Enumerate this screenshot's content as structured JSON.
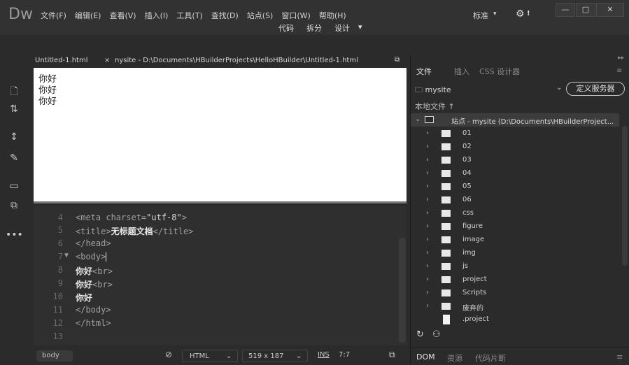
{
  "app": {
    "logo": "Dw"
  },
  "menu": [
    "文件(F)",
    "编辑(E)",
    "查看(V)",
    "插入(I)",
    "工具(T)",
    "查找(D)",
    "站点(S)",
    "窗口(W)",
    "帮助(H)"
  ],
  "workspace": {
    "preset": "标准",
    "caret": "▾",
    "settings_badge": "!"
  },
  "window_controls": {
    "minimize": "—",
    "maximize": "□",
    "close": "✕"
  },
  "views": {
    "code": "代码",
    "split": "拆分",
    "design": "设计",
    "caret": "▾"
  },
  "document": {
    "tab_name": "Untitled-1.html",
    "close": "×",
    "path": "nysite - D:\\Documents\\HBuilderProjects\\HelloHBuilder\\Untitled-1.html"
  },
  "design_view": {
    "lines": [
      "你好",
      "你好",
      "你好"
    ]
  },
  "code_view": {
    "rows": [
      {
        "ln": "4",
        "fold": "",
        "html": "meta"
      },
      {
        "ln": "5",
        "fold": "",
        "html": "title"
      },
      {
        "ln": "6",
        "fold": "",
        "html": "head_close"
      },
      {
        "ln": "7",
        "fold": "▼",
        "html": "body_open"
      },
      {
        "ln": "8",
        "fold": "",
        "html": "hello_br"
      },
      {
        "ln": "9",
        "fold": "",
        "html": "hello_br"
      },
      {
        "ln": "10",
        "fold": "",
        "html": "hello"
      },
      {
        "ln": "11",
        "fold": "",
        "html": "body_close"
      },
      {
        "ln": "12",
        "fold": "",
        "html": "html_close"
      },
      {
        "ln": "13",
        "fold": "",
        "html": "empty"
      }
    ],
    "meta_open": "<meta charset=",
    "meta_val": "\"utf-8\"",
    "meta_close": ">",
    "title_open": "<title>",
    "title_text": "无标题文档",
    "title_close": "</title>",
    "head_close": "</head>",
    "body_open": "<body>",
    "hello": "你好",
    "br": "<br>",
    "body_close": "</body>",
    "html_close": "</html>"
  },
  "status_bar": {
    "tag": "body",
    "language": "HTML",
    "size": "519 x 187",
    "mode": "INS",
    "position": "7:7"
  },
  "right_panel": {
    "tabs": [
      "文件",
      "插入",
      "CSS 设计器"
    ],
    "site": "mysite",
    "define_server": "定义服务器",
    "local_files": "本地文件",
    "local_files_arrow": "↑",
    "root": "站点 - mysite (D:\\Documents\\HBuilderProject...",
    "items": [
      {
        "name": "01",
        "type": "folder"
      },
      {
        "name": "02",
        "type": "folder"
      },
      {
        "name": "03",
        "type": "folder"
      },
      {
        "name": "04",
        "type": "folder"
      },
      {
        "name": "05",
        "type": "folder"
      },
      {
        "name": "06",
        "type": "folder"
      },
      {
        "name": "css",
        "type": "folder"
      },
      {
        "name": "figure",
        "type": "folder"
      },
      {
        "name": "image",
        "type": "folder"
      },
      {
        "name": "img",
        "type": "folder"
      },
      {
        "name": "js",
        "type": "folder"
      },
      {
        "name": "project",
        "type": "folder"
      },
      {
        "name": "Scripts",
        "type": "folder"
      },
      {
        "name": "废弃的",
        "type": "folder"
      },
      {
        "name": ".project",
        "type": "file"
      }
    ],
    "bottom_tabs": [
      "DOM",
      "资源",
      "代码片断"
    ]
  }
}
